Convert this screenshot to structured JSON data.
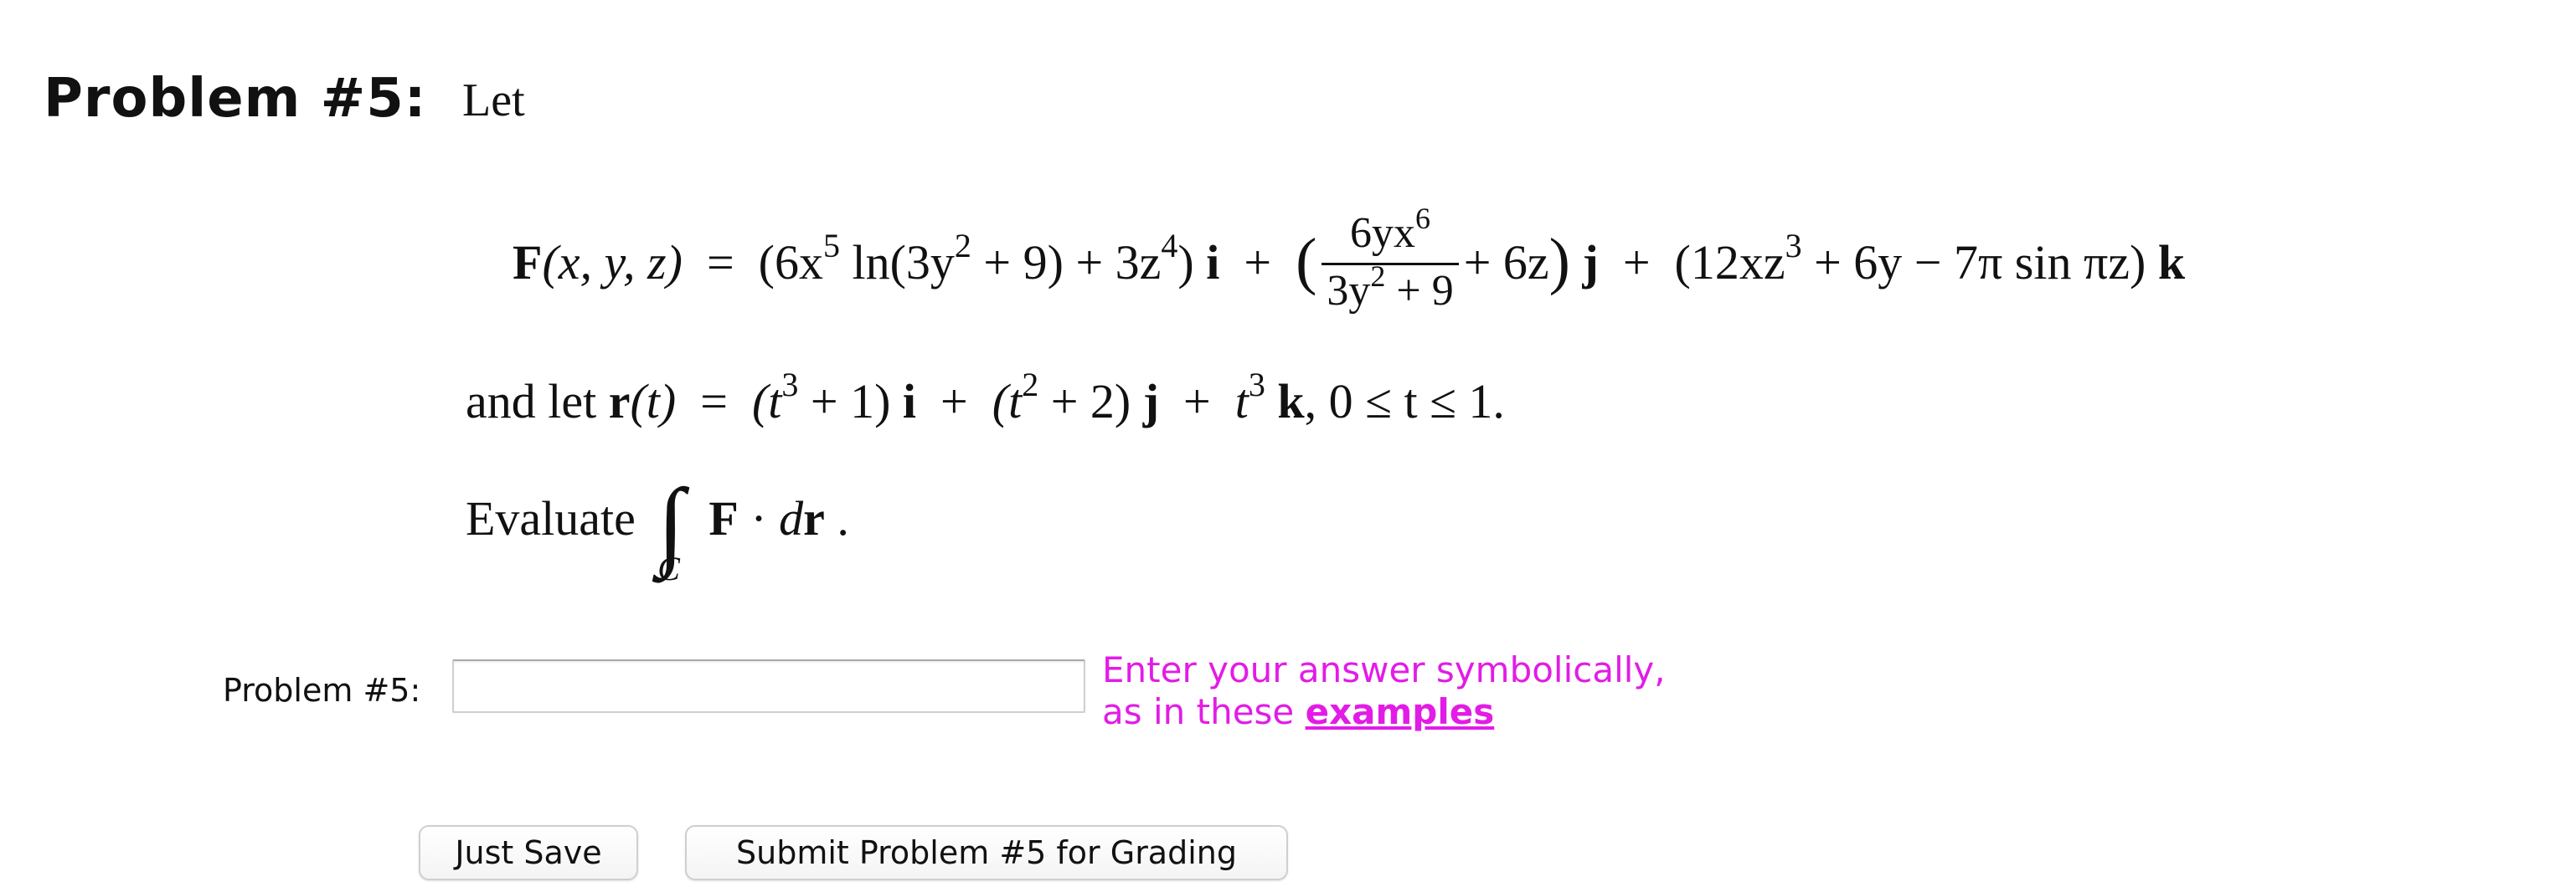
{
  "problem": {
    "heading": "Problem #5:",
    "intro": "Let",
    "field": {
      "lhs_F": "F",
      "lhs_args": "(x, y, z)",
      "equals": "=",
      "i_component_open": "(6x",
      "i_exp1": "5",
      "i_component_mid": " ln(3y",
      "i_exp2": "2",
      "i_component_mid2": " + 9) + 3z",
      "i_exp3": "4",
      "i_component_close": ")",
      "unit_i": "i",
      "plus": "+",
      "frac_num_base": "6yx",
      "frac_num_exp": "6",
      "frac_den_base": "3y",
      "frac_den_exp": "2",
      "frac_den_tail": " + 9",
      "j_tail": "+ 6z",
      "unit_j": "j",
      "k_component_open": "(12xz",
      "k_exp": "3",
      "k_component_rest": " + 6y − 7π sin πz)",
      "unit_k": "k"
    },
    "path": {
      "lead": "and let",
      "r": "r",
      "r_arg": "(t)",
      "equals": "=",
      "part1_open": "(t",
      "part1_exp": "3",
      "part1_close": " + 1)",
      "unit_i": "i",
      "plus": "+",
      "part2_open": "(t",
      "part2_exp": "2",
      "part2_close": " + 2)",
      "unit_j": "j",
      "part3_base": "t",
      "part3_exp": "3",
      "unit_k": "k",
      "range": ",  0  ≤  t  ≤  1."
    },
    "evaluate": {
      "lead": "Evaluate",
      "integral_sign": "∫",
      "subscript": "C",
      "F": "F",
      "dot": "·",
      "d": "d",
      "r": "r",
      "period": "."
    }
  },
  "form": {
    "row_label": "Problem #5:",
    "answer_value": "",
    "hint_line1": "Enter your answer symbolically,",
    "hint_line2_prefix": "as in these ",
    "hint_link": "examples",
    "just_save_label": "Just Save",
    "submit_label": "Submit Problem #5 for Grading"
  },
  "colors": {
    "hint": "#e21ce6",
    "text": "#111111"
  }
}
